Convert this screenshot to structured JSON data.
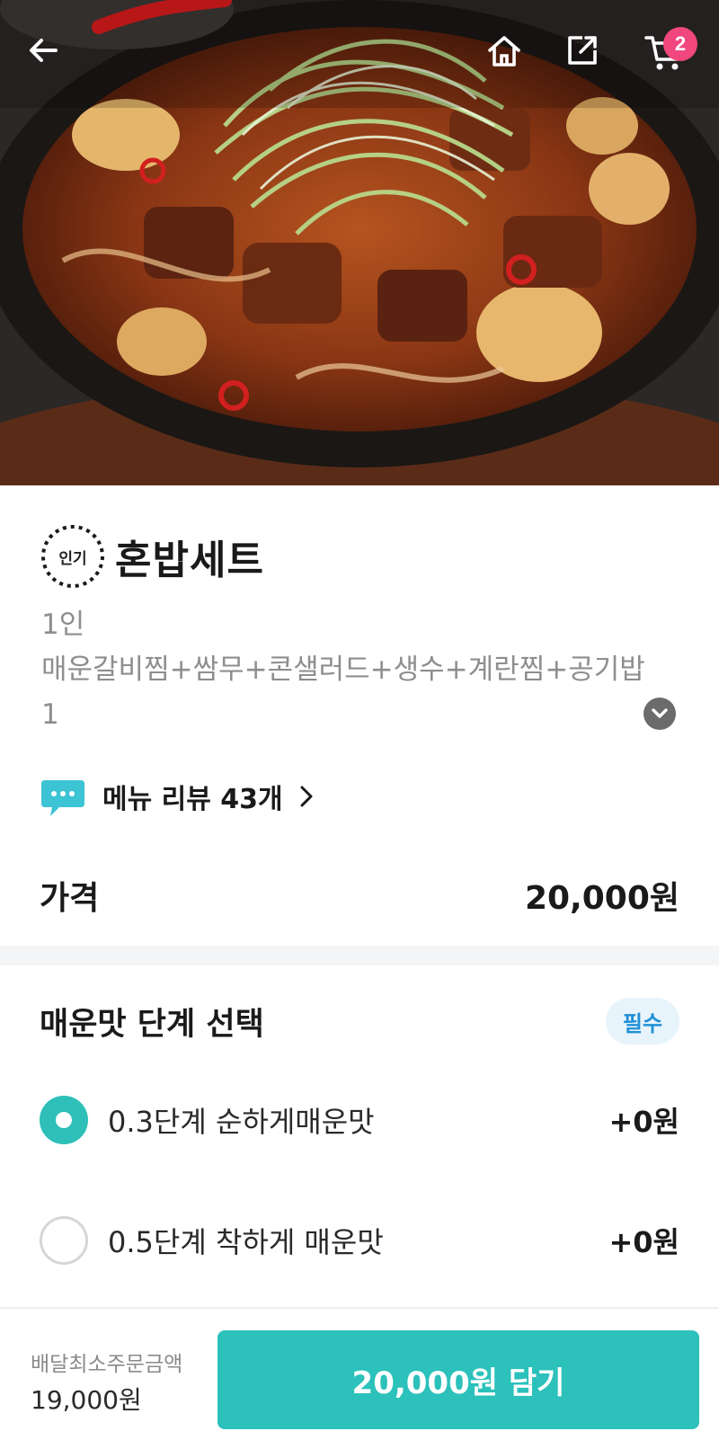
{
  "header": {
    "cart_count": "2",
    "icons": [
      "back-arrow-icon",
      "home-icon",
      "share-icon",
      "cart-icon"
    ]
  },
  "product": {
    "badge": "인기",
    "title": "혼밥세트",
    "description": "1인\n매운갈비찜+쌈무+콘샐러드+생수+계란찜+공기밥1",
    "review_label": "메뉴 리뷰 43개",
    "price_label": "가격",
    "price_value": "20,000원"
  },
  "options": {
    "title": "매운맛 단계 선택",
    "required_badge": "필수",
    "items": [
      {
        "label": "0.3단계 순하게매운맛",
        "price": "+0원",
        "selected": true
      },
      {
        "label": "0.5단계 착하게 매운맛",
        "price": "+0원",
        "selected": false
      }
    ]
  },
  "footer": {
    "min_order_label": "배달최소주문금액",
    "min_order_value": "19,000원",
    "cta_label": "20,000원 담기"
  },
  "colors": {
    "accent": "#2cc1bb",
    "badge_pink": "#f0477f",
    "required_blue": "#1f8fd6",
    "review_icon": "#3cc3d4"
  }
}
